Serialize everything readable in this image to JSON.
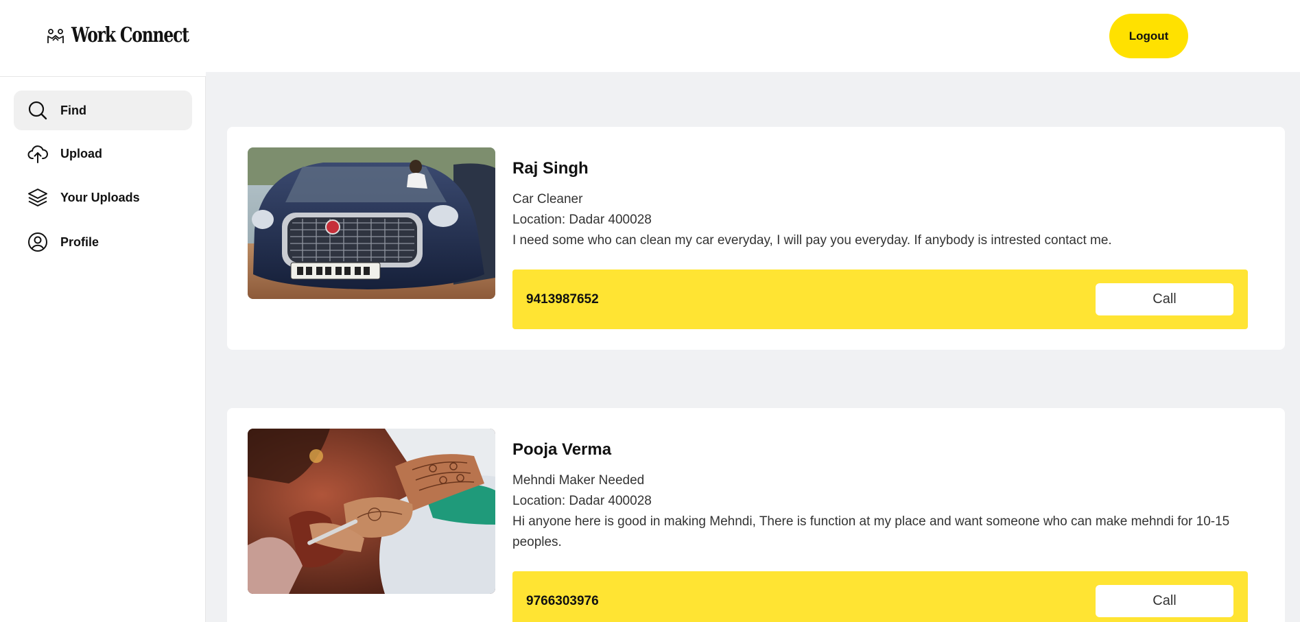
{
  "app": {
    "title": "Work Connect",
    "logout_label": "Logout",
    "accent_color": "#ffe100"
  },
  "sidebar": {
    "items": [
      {
        "label": "Find",
        "icon": "search-icon",
        "active": true
      },
      {
        "label": "Upload",
        "icon": "cloud-upload-icon",
        "active": false
      },
      {
        "label": "Your Uploads",
        "icon": "layers-icon",
        "active": false
      },
      {
        "label": "Profile",
        "icon": "user-circle-icon",
        "active": false
      }
    ]
  },
  "listings": [
    {
      "name": "Raj Singh",
      "title": "Car Cleaner",
      "location": "Location: Dadar 400028",
      "description": "I need some who can clean my car everyday, I will pay you everyday. If anybody is intrested contact me.",
      "phone": "9413987652",
      "call_label": "Call",
      "image": "car-photo"
    },
    {
      "name": "Pooja Verma",
      "title": "Mehndi Maker Needed",
      "location": "Location: Dadar 400028",
      "description": "Hi anyone here is good in making Mehndi, There is function at my place and want someone who can make mehndi for 10-15 peoples.",
      "phone": "9766303976",
      "call_label": "Call",
      "image": "mehndi-photo"
    }
  ]
}
